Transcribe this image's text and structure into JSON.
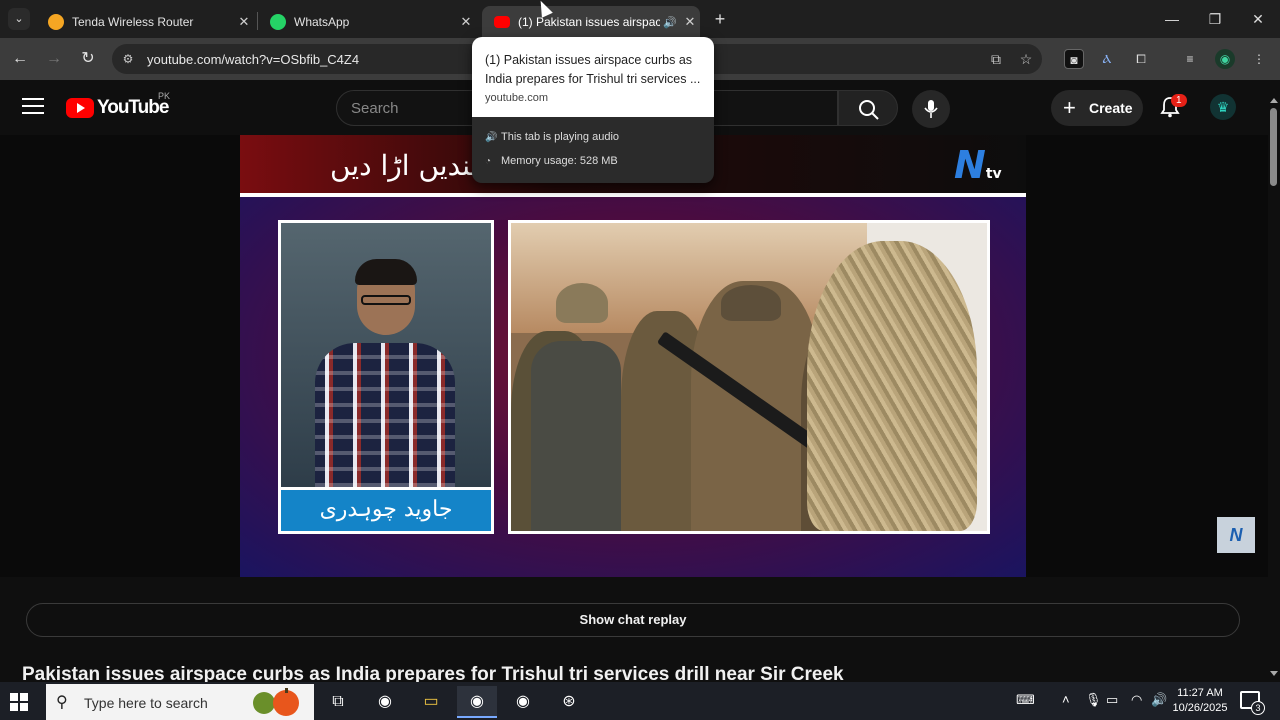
{
  "browser": {
    "tabs": [
      {
        "title": "Tenda Wireless Router",
        "favicon": "tenda-icon",
        "color": "#f5a623"
      },
      {
        "title": "WhatsApp",
        "favicon": "whatsapp-icon",
        "color": "#25d366"
      },
      {
        "title": "(1) Pakistan issues airspace",
        "favicon": "youtube-icon",
        "color": "#ff0000",
        "active": true,
        "playing_audio": true
      }
    ],
    "new_tab_symbol": "+",
    "window_controls": {
      "minimize": "—",
      "maximize": "❐",
      "close": "✕"
    },
    "url": "youtube.com/watch?v=OSbfib_C4Z4",
    "nav": {
      "back": "←",
      "forward": "→",
      "reload": "↻"
    }
  },
  "hovercard": {
    "title": "(1) Pakistan issues airspace curbs as India prepares for Trishul tri services ...",
    "domain": "youtube.com",
    "audio_text": "This tab is playing audio",
    "memory_text": "Memory usage: 528 MB"
  },
  "youtube": {
    "logo_text": "YouTube",
    "country_code": "PK",
    "search_placeholder": "Search",
    "create_label": "Create",
    "notification_count": "1",
    "video": {
      "banner_urdu": "پاک بحریہ ... سندیں اڑا دیں",
      "channel_logo": "N",
      "channel_logo_suffix": "tv",
      "anchor_name_urdu": "جاوید چوہدری"
    },
    "chat_replay_label": "Show chat replay",
    "title": "Pakistan issues airspace curbs as India prepares for Trishul tri services drill near Sir Creek"
  },
  "taskbar": {
    "search_placeholder": "Type here to search",
    "time": "11:27 AM",
    "date": "10/26/2025",
    "notification_count": "3"
  }
}
